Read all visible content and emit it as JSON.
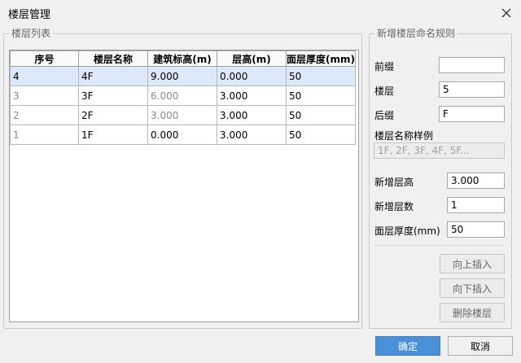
{
  "window": {
    "title": "楼层管理"
  },
  "floor_list": {
    "title": "楼层列表",
    "columns": [
      "序号",
      "楼层名称",
      "建筑标高(m)",
      "层高(m)",
      "面层厚度(mm)"
    ],
    "rows": [
      {
        "index": "4",
        "name": "4F",
        "elevation": "9.000",
        "height": "0.000",
        "thickness": "50"
      },
      {
        "index": "3",
        "name": "3F",
        "elevation": "6.000",
        "height": "3.000",
        "thickness": "50"
      },
      {
        "index": "2",
        "name": "2F",
        "elevation": "3.000",
        "height": "3.000",
        "thickness": "50"
      },
      {
        "index": "1",
        "name": "1F",
        "elevation": "0.000",
        "height": "3.000",
        "thickness": "50"
      }
    ]
  },
  "naming_rule": {
    "title": "新增楼层命名规则",
    "prefix_label": "前缀",
    "prefix_value": "",
    "floor_label": "楼层",
    "floor_value": "5",
    "suffix_label": "后缀",
    "suffix_value": "F",
    "example_label": "楼层名称样例",
    "example_value": "1F, 2F, 3F, 4F, 5F...",
    "new_height_label": "新增层高",
    "new_height_value": "3.000",
    "new_count_label": "新增层数",
    "new_count_value": "1",
    "thickness_label": "面层厚度(mm)",
    "thickness_value": "50",
    "insert_above": "向上插入",
    "insert_below": "向下插入",
    "delete_floor": "删除楼层"
  },
  "footer": {
    "ok": "确定",
    "cancel": "取消"
  }
}
